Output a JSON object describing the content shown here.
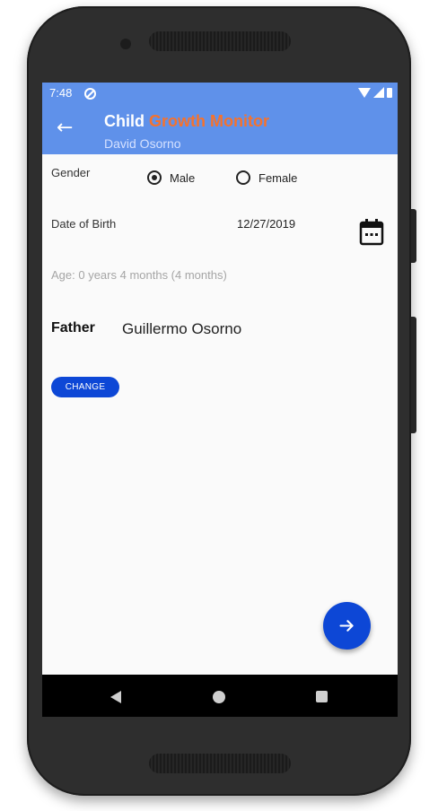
{
  "status_bar": {
    "time": "7:48",
    "icons": [
      "do-not-disturb-icon",
      "wifi-icon",
      "signal-icon",
      "battery-icon"
    ]
  },
  "app_bar": {
    "title_part1": "Child",
    "title_part2": "Growth Monitor",
    "subtitle": "David Osorno",
    "back_icon": "arrow-left-icon"
  },
  "form": {
    "gender_label": "Gender",
    "gender_options": [
      {
        "label": "Male",
        "selected": true
      },
      {
        "label": "Female",
        "selected": false
      }
    ],
    "dob_label": "Date of Birth",
    "dob_value": "12/27/2019",
    "calendar_icon": "calendar-icon",
    "age_text": "Age: 0 years 4 months (4 months)",
    "father_label": "Father",
    "father_name": "Guillermo Osorno",
    "change_button": "CHANGE"
  },
  "fab": {
    "icon": "arrow-right-icon"
  },
  "nav_bar": {
    "icons": [
      "back-triangle-icon",
      "home-circle-icon",
      "recents-square-icon"
    ]
  },
  "colors": {
    "app_bar": "#5f91ea",
    "title_accent": "#f5722d",
    "primary_button": "#0d47d6",
    "background": "#fafafa"
  }
}
